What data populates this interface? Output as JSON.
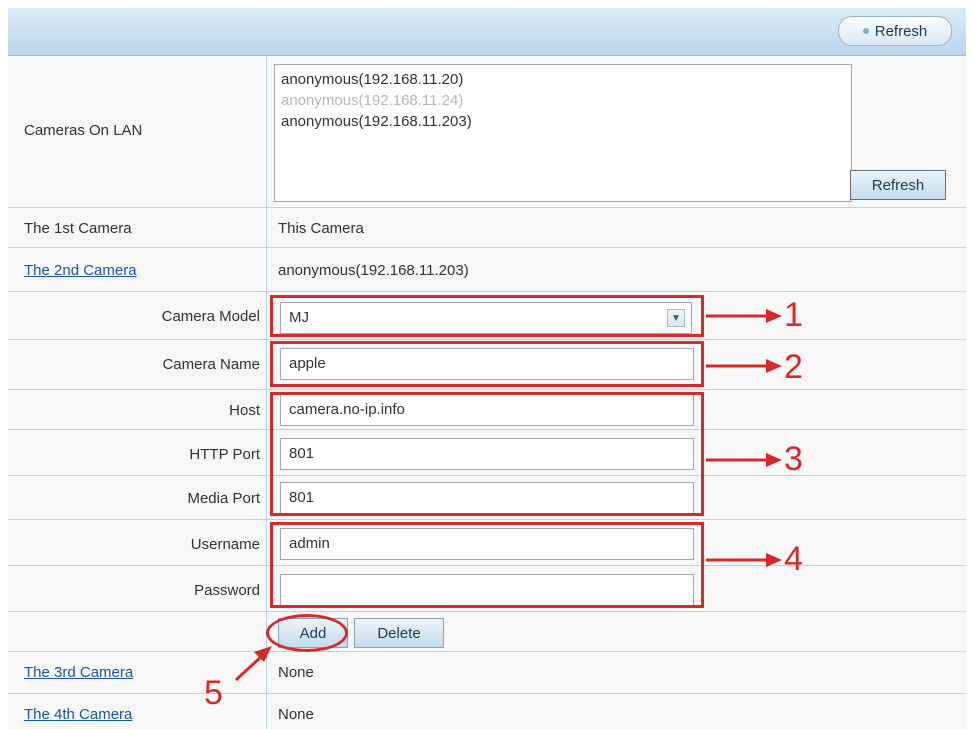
{
  "toolbar": {
    "refresh_label": "Refresh"
  },
  "lan": {
    "label": "Cameras On LAN",
    "items": [
      "anonymous(192.168.11.20)",
      "anonymous(192.168.11.24)",
      "anonymous(192.168.11.203)"
    ],
    "refresh_label": "Refresh"
  },
  "cameras": {
    "first": {
      "label": "The 1st Camera",
      "value": "This Camera"
    },
    "second": {
      "label": "The 2nd Camera",
      "value": "anonymous(192.168.11.203)"
    },
    "third": {
      "label": "The 3rd Camera",
      "value": "None"
    },
    "fourth": {
      "label": "The 4th Camera",
      "value": "None"
    }
  },
  "form": {
    "model_label": "Camera Model",
    "model_value": "MJ",
    "name_label": "Camera Name",
    "name_value": "apple",
    "host_label": "Host",
    "host_value": "camera.no-ip.info",
    "http_label": "HTTP Port",
    "http_value": "801",
    "media_label": "Media Port",
    "media_value": "801",
    "user_label": "Username",
    "user_value": "admin",
    "pass_label": "Password",
    "pass_value": "",
    "add_label": "Add",
    "delete_label": "Delete"
  },
  "annotations": [
    "1",
    "2",
    "3",
    "4",
    "5"
  ],
  "colors": {
    "accent_red": "#d62a2a",
    "header_blue": "#b9d5ec",
    "link_blue": "#1d55a8"
  },
  "icons": {
    "select_arrow": "chevron-down-icon",
    "refresh_dot": "refresh-icon"
  }
}
